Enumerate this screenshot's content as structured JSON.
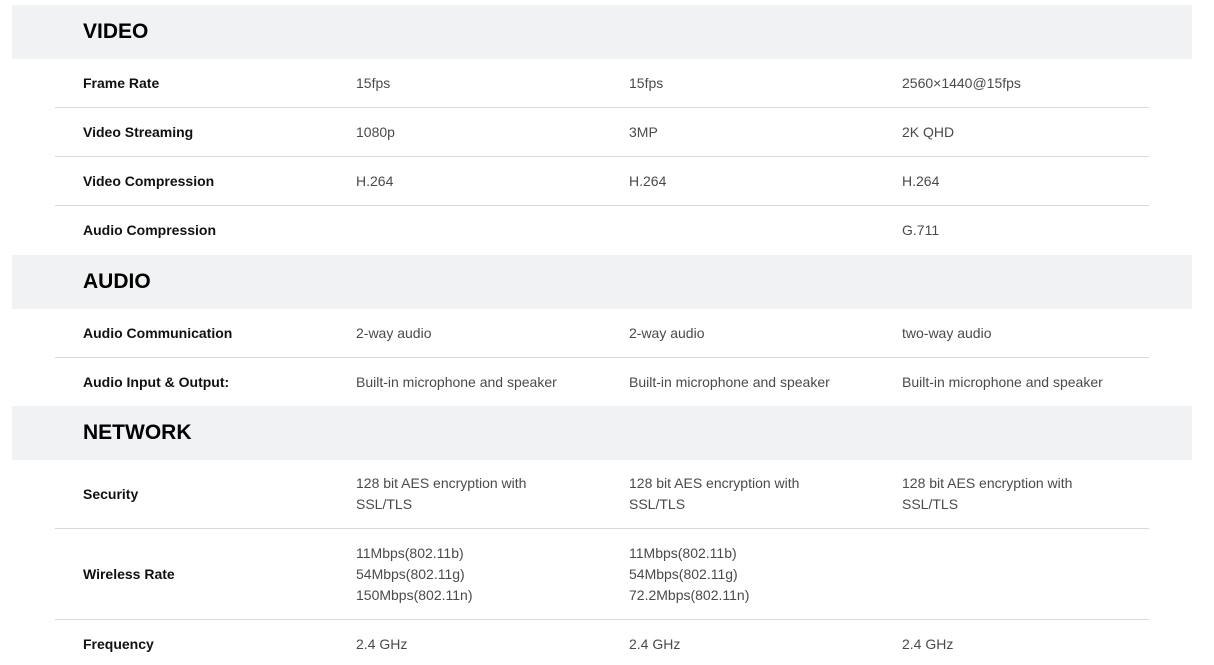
{
  "sections": [
    {
      "title": "VIDEO",
      "rows": [
        {
          "label": "Frame Rate",
          "values": [
            [
              "15fps"
            ],
            [
              "15fps"
            ],
            [
              "2560×1440@15fps"
            ]
          ]
        },
        {
          "label": "Video Streaming",
          "values": [
            [
              "1080p"
            ],
            [
              "3MP"
            ],
            [
              "2K QHD"
            ]
          ]
        },
        {
          "label": "Video Compression",
          "values": [
            [
              "H.264"
            ],
            [
              "H.264"
            ],
            [
              "H.264"
            ]
          ]
        },
        {
          "label": "Audio Compression",
          "values": [
            [
              ""
            ],
            [
              ""
            ],
            [
              "G.711"
            ]
          ]
        }
      ]
    },
    {
      "title": "AUDIO",
      "rows": [
        {
          "label": "Audio Communication",
          "values": [
            [
              "2-way audio"
            ],
            [
              "2-way audio"
            ],
            [
              "two-way audio"
            ]
          ]
        },
        {
          "label": "Audio Input & Output:",
          "values": [
            [
              "Built-in microphone and speaker"
            ],
            [
              "Built-in microphone and speaker"
            ],
            [
              "Built-in microphone and speaker"
            ]
          ]
        }
      ]
    },
    {
      "title": "NETWORK",
      "rows": [
        {
          "label": "Security",
          "values": [
            [
              "128 bit AES encryption with",
              "SSL/TLS"
            ],
            [
              "128 bit AES encryption with",
              "SSL/TLS"
            ],
            [
              "128 bit AES encryption with",
              "SSL/TLS"
            ]
          ]
        },
        {
          "label": "Wireless Rate",
          "values": [
            [
              "11Mbps(802.11b)",
              "54Mbps(802.11g)",
              "150Mbps(802.11n)"
            ],
            [
              "11Mbps(802.11b)",
              "54Mbps(802.11g)",
              "72.2Mbps(802.11n)"
            ],
            [
              ""
            ]
          ]
        },
        {
          "label": "Frequency",
          "values": [
            [
              "2.4 GHz"
            ],
            [
              "2.4 GHz"
            ],
            [
              "2.4 GHz"
            ]
          ]
        }
      ]
    }
  ]
}
